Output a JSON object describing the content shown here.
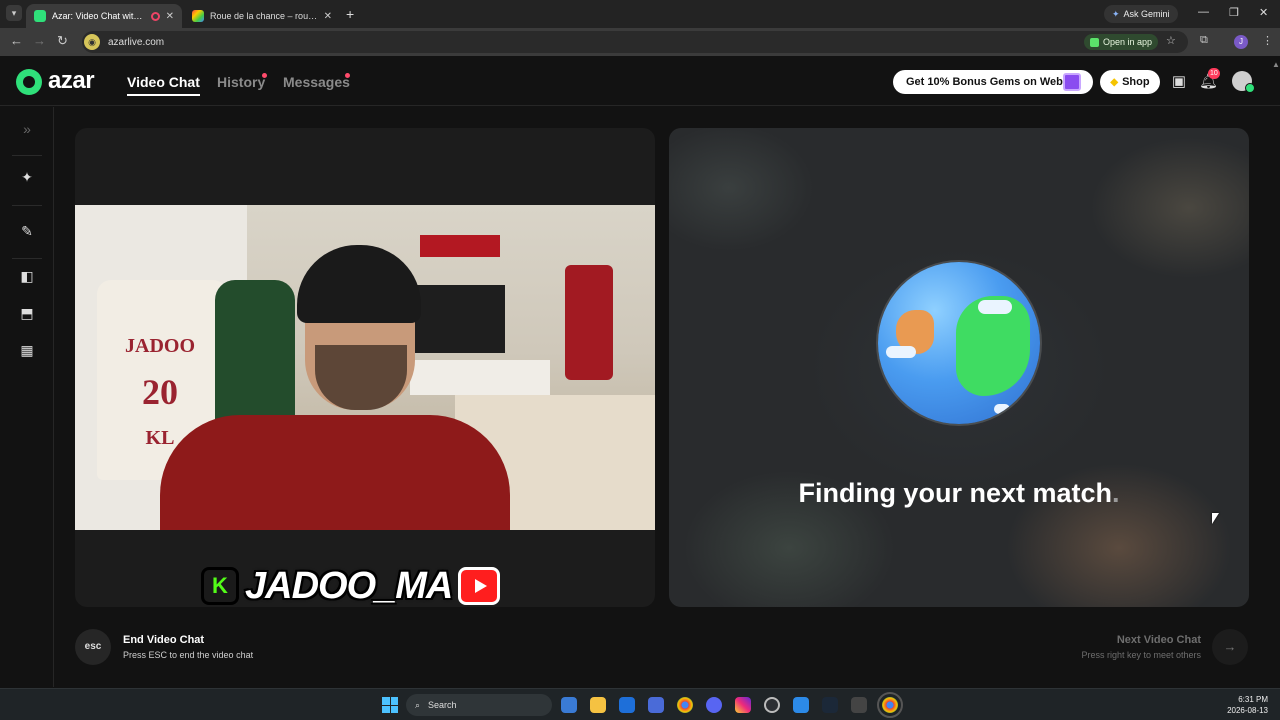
{
  "browser": {
    "tabs": [
      {
        "title": "Azar: Video Chat with New"
      },
      {
        "title": "Roue de la chance – roue aléatoire"
      }
    ],
    "ask_gemini": "Ask Gemini",
    "url": "azarlive.com",
    "open_in_app": "Open in app",
    "profile_initial": "J"
  },
  "app": {
    "logo_text": "azar",
    "nav": {
      "video_chat": "Video Chat",
      "history": "History",
      "messages": "Messages"
    },
    "bonus_button": "Get 10% Bonus Gems on Web!",
    "shop_button": "Shop",
    "notification_count": "10"
  },
  "stream_overlay": {
    "name": "JADOO_MA",
    "kick_letter": "K"
  },
  "webcam_scene": {
    "jersey_text_line1": "JADOO",
    "jersey_text_line2": "20",
    "jersey_text_line3": "KL"
  },
  "match": {
    "finding_text": "Finding your next match",
    "dots": "."
  },
  "controls": {
    "esc_key": "esc",
    "end_title": "End Video Chat",
    "end_sub": "Press ESC to end the video chat",
    "next_title": "Next Video Chat",
    "next_sub": "Press right key to meet others"
  },
  "taskbar": {
    "search_placeholder": "Search",
    "time": "6:31 PM",
    "date": "2026-08-13"
  },
  "colors": {
    "brand_green": "#2fe07a",
    "badge_red": "#ff4b6b",
    "background": "#121212"
  }
}
